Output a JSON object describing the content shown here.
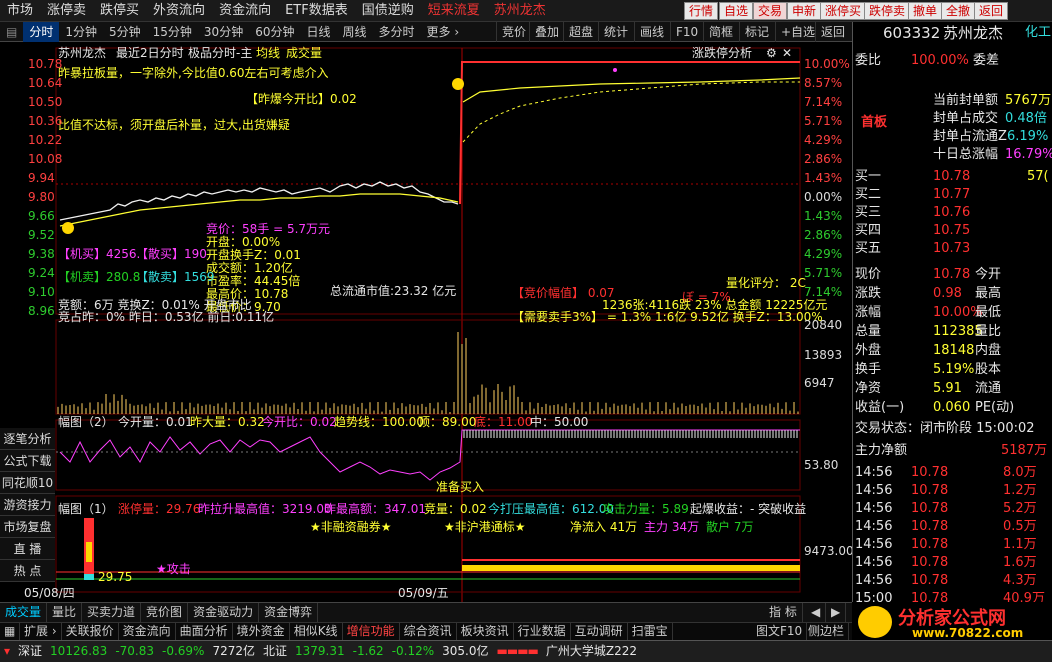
{
  "top_menu": {
    "items": [
      "市场",
      "涨停卖",
      "跌停买",
      "外资流向",
      "资金流向",
      "ETF数据表",
      "国债逆购"
    ],
    "tag_red": "短来流夏",
    "tag_stock": "苏州龙杰",
    "buttons": [
      "行情",
      "自选",
      "交易",
      "申新",
      "涨停买",
      "跌停卖",
      "撤单",
      "全撤",
      "返回"
    ]
  },
  "toolbar2": {
    "items": [
      "分时",
      "1分钟",
      "5分钟",
      "15分钟",
      "30分钟",
      "60分钟",
      "日线",
      "周线",
      "多分时",
      "更多 ›"
    ],
    "right": [
      "竞价",
      "叠加",
      "超盘",
      "统计",
      "画线",
      "F10",
      "简框",
      "标记",
      "+自选",
      "返回"
    ]
  },
  "chart_header": {
    "stock": "苏州龙杰",
    "mode": "最近2日分时",
    "indicator": "极品分时-主",
    "avg_label": "均线",
    "vol_label": "成交量",
    "right_title": "涨跌停分析"
  },
  "annotations": {
    "note1": "昨暴拉板量，一字除外,今比值0.60左右可考虑介入",
    "note2": "【昨爆今开比】0.02",
    "note3": "比值不达标，须开盘后补量，过大,出货嫌疑",
    "auction": "竞价：58手 = 5.7万元",
    "open_pct": "开盘：0.00%",
    "open_turn": "开盘换手Z：0.01",
    "amount": "成交额：1.20亿",
    "pe": "市盈率：44.45倍",
    "high": "最高价：10.78",
    "low": "最低价：9.70",
    "jibuy": "【机买】4256.",
    "sanmai": "【散买】190",
    "jisell": "【机卖】280.8",
    "sanmai2": "【散卖】1569",
    "float_mv": "总流通市值:23.32 亿元",
    "auction_amp": "【竞价幅值】  0.07",
    "limit_pct": "ぼ = 7%",
    "quant_score": "量化评分：  2C",
    "line1": "竞额：6万  竞换Z：0.01%  开盘市比",
    "line2": "竞占昨：0%  昨日：0.53亿  前日:0.11亿",
    "line3": "1236张:4116跌 23% 总金额  12225亿元",
    "line4": "【需要卖手3%】 = 1.3%  1:6亿 9.52亿  换手Z：13.00%",
    "fukuan": "幅图（2）",
    "open_vol": "今开量：0.01",
    "prev_vol": "昨大量：0.32",
    "open_ratio": "今开比：0.02",
    "trend": "趋势线：100.00",
    "top": "顶：89.00",
    "bottom": "底：11.00",
    "mid": "中：50.00",
    "zhunbei": "准备买入",
    "fukuan1": "幅图（1）",
    "limit_vol": "涨停量：29.76",
    "rise_high": "昨拉升最高值：3219.00",
    "prev_high": "昨最高额：347.01",
    "jingliang": "竞量：0.02",
    "today_high": "今打压最高值：612.00",
    "attack": "攻击力量：5.89",
    "breakout": "起爆收益：- 突破收益",
    "nonmargin": "★非融资融券★",
    "non_hk": "★非沪港通标★",
    "netflow": "净流入 41万",
    "main": "主力 34万",
    "retail": "散户 7万",
    "gongji": "★攻击",
    "buy_val": "29.75",
    "vol_9473": "9473.00",
    "ma": "53.80"
  },
  "axes": {
    "price_left": [
      "10.78",
      "10.64",
      "10.50",
      "10.36",
      "10.22",
      "10.08",
      "9.94",
      "9.80",
      "9.66",
      "9.52",
      "9.38",
      "9.24",
      "9.10",
      "8.96"
    ],
    "pct_right": [
      "10.00%",
      "8.57%",
      "7.14%",
      "5.71%",
      "4.29%",
      "2.86%",
      "1.43%",
      "0.00%",
      "1.43%",
      "2.86%",
      "4.29%",
      "5.71%",
      "7.14%"
    ],
    "vol_right": [
      "20840",
      "13893",
      "6947"
    ],
    "dates": [
      "05/08/四",
      "05/09/五"
    ]
  },
  "side_tabs": [
    "逐笔分析",
    "公式下载",
    "同花顺10",
    "游资接力",
    "市场复盘",
    "直  播",
    "热  点"
  ],
  "right_panel": {
    "code": "603332",
    "name": "苏州龙杰",
    "tag": "化工+军",
    "weibi_label": "委比",
    "weibi": "100.00%",
    "weicha_label": "委差",
    "board_label": "首板",
    "seal_amount_label": "当前封单额",
    "seal_amount": "5767万",
    "seal_ratio_label": "封单占成交",
    "seal_ratio": "0.48倍",
    "seal_float_label": "封单占流通Z",
    "seal_float": "6.19%",
    "ten_day_label": "十日总涨幅",
    "ten_day": "16.79%",
    "asks": [
      {
        "label": "卖五",
        "price": "",
        "vol": ""
      },
      {
        "label": "卖四",
        "price": "",
        "vol": ""
      },
      {
        "label": "卖三",
        "price": "",
        "vol": ""
      },
      {
        "label": "卖二",
        "price": "",
        "vol": ""
      },
      {
        "label": "卖一",
        "price": "",
        "vol": ""
      }
    ],
    "bids": [
      {
        "label": "买一",
        "price": "10.78",
        "vol": "57("
      },
      {
        "label": "买二",
        "price": "10.77",
        "vol": ""
      },
      {
        "label": "买三",
        "price": "10.76",
        "vol": ""
      },
      {
        "label": "买四",
        "price": "10.75",
        "vol": ""
      },
      {
        "label": "买五",
        "price": "10.73",
        "vol": ""
      }
    ],
    "stats": [
      {
        "l1": "现价",
        "v1": "10.78",
        "l2": "今开",
        "v2": ""
      },
      {
        "l1": "涨跌",
        "v1": "0.98",
        "l2": "最高",
        "v2": ""
      },
      {
        "l1": "涨幅",
        "v1": "10.00%",
        "l2": "最低",
        "v2": ""
      },
      {
        "l1": "总量",
        "v1": "112385",
        "l2": "量比",
        "v2": ""
      },
      {
        "l1": "外盘",
        "v1": "18148",
        "l2": "内盘",
        "v2": ""
      },
      {
        "l1": "换手",
        "v1": "5.19%",
        "l2": "股本",
        "v2": ""
      },
      {
        "l1": "净资",
        "v1": "5.91",
        "l2": "流通",
        "v2": ""
      },
      {
        "l1": "收益(一)",
        "v1": "0.060",
        "l2": "PE(动)",
        "v2": ""
      }
    ],
    "trade_state": "交易状态：闭市阶段 15:00:02",
    "net_main_label": "主力净额",
    "net_main": "5187万",
    "ticks": [
      {
        "t": "14:56",
        "p": "10.78",
        "v": "8.0万"
      },
      {
        "t": "14:56",
        "p": "10.78",
        "v": "1.2万"
      },
      {
        "t": "14:56",
        "p": "10.78",
        "v": "5.2万"
      },
      {
        "t": "14:56",
        "p": "10.78",
        "v": "0.5万"
      },
      {
        "t": "14:56",
        "p": "10.78",
        "v": "1.1万"
      },
      {
        "t": "14:56",
        "p": "10.78",
        "v": "1.6万"
      },
      {
        "t": "14:56",
        "p": "10.78",
        "v": "4.3万"
      },
      {
        "t": "15:00",
        "p": "10.78",
        "v": "40.9万"
      }
    ]
  },
  "bottom_tabs": [
    "成交量",
    "量比",
    "买卖力道",
    "竞价图",
    "资金驱动力",
    "资金博弈"
  ],
  "bottom_right": [
    "指 标",
    "◀",
    "▶"
  ],
  "func_bar": [
    "扩展 ›",
    "关联报价",
    "资金流向",
    "曲面分析",
    "境外资金",
    "相似K线",
    "增信功能",
    "综合资讯",
    "板块资讯",
    "行业数据",
    "互动调研",
    "扫雷宝",
    "图文F10",
    "侧边栏"
  ],
  "status_bar": {
    "sz_label": "深证",
    "sz_val": "10126.83",
    "sz_chg": "-70.83",
    "sz_pct": "-0.69%",
    "sz_amt": "7272亿",
    "bz_label": "北证",
    "bz_val": "1379.31",
    "bz_chg": "-1.62",
    "bz_pct": "-0.12%",
    "bz_amt": "305.0亿",
    "broker": "广州大学城Z222"
  },
  "logo": {
    "text": "分析家公式网",
    "url_text": "www.70822.com"
  },
  "colors": {
    "up": "#ff3030",
    "down": "#23d023",
    "accent": "#ffff33",
    "select": "#003070"
  }
}
